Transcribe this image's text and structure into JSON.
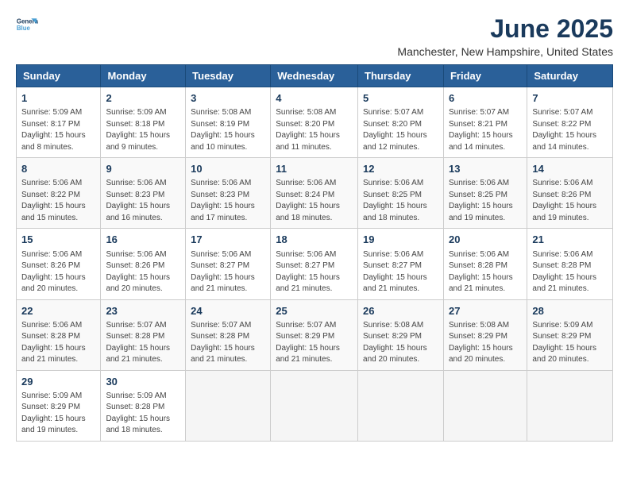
{
  "logo": {
    "line1": "General",
    "line2": "Blue"
  },
  "title": "June 2025",
  "subtitle": "Manchester, New Hampshire, United States",
  "headers": [
    "Sunday",
    "Monday",
    "Tuesday",
    "Wednesday",
    "Thursday",
    "Friday",
    "Saturday"
  ],
  "weeks": [
    [
      {
        "day": "1",
        "info": "Sunrise: 5:09 AM\nSunset: 8:17 PM\nDaylight: 15 hours\nand 8 minutes."
      },
      {
        "day": "2",
        "info": "Sunrise: 5:09 AM\nSunset: 8:18 PM\nDaylight: 15 hours\nand 9 minutes."
      },
      {
        "day": "3",
        "info": "Sunrise: 5:08 AM\nSunset: 8:19 PM\nDaylight: 15 hours\nand 10 minutes."
      },
      {
        "day": "4",
        "info": "Sunrise: 5:08 AM\nSunset: 8:20 PM\nDaylight: 15 hours\nand 11 minutes."
      },
      {
        "day": "5",
        "info": "Sunrise: 5:07 AM\nSunset: 8:20 PM\nDaylight: 15 hours\nand 12 minutes."
      },
      {
        "day": "6",
        "info": "Sunrise: 5:07 AM\nSunset: 8:21 PM\nDaylight: 15 hours\nand 14 minutes."
      },
      {
        "day": "7",
        "info": "Sunrise: 5:07 AM\nSunset: 8:22 PM\nDaylight: 15 hours\nand 14 minutes."
      }
    ],
    [
      {
        "day": "8",
        "info": "Sunrise: 5:06 AM\nSunset: 8:22 PM\nDaylight: 15 hours\nand 15 minutes."
      },
      {
        "day": "9",
        "info": "Sunrise: 5:06 AM\nSunset: 8:23 PM\nDaylight: 15 hours\nand 16 minutes."
      },
      {
        "day": "10",
        "info": "Sunrise: 5:06 AM\nSunset: 8:23 PM\nDaylight: 15 hours\nand 17 minutes."
      },
      {
        "day": "11",
        "info": "Sunrise: 5:06 AM\nSunset: 8:24 PM\nDaylight: 15 hours\nand 18 minutes."
      },
      {
        "day": "12",
        "info": "Sunrise: 5:06 AM\nSunset: 8:25 PM\nDaylight: 15 hours\nand 18 minutes."
      },
      {
        "day": "13",
        "info": "Sunrise: 5:06 AM\nSunset: 8:25 PM\nDaylight: 15 hours\nand 19 minutes."
      },
      {
        "day": "14",
        "info": "Sunrise: 5:06 AM\nSunset: 8:26 PM\nDaylight: 15 hours\nand 19 minutes."
      }
    ],
    [
      {
        "day": "15",
        "info": "Sunrise: 5:06 AM\nSunset: 8:26 PM\nDaylight: 15 hours\nand 20 minutes."
      },
      {
        "day": "16",
        "info": "Sunrise: 5:06 AM\nSunset: 8:26 PM\nDaylight: 15 hours\nand 20 minutes."
      },
      {
        "day": "17",
        "info": "Sunrise: 5:06 AM\nSunset: 8:27 PM\nDaylight: 15 hours\nand 21 minutes."
      },
      {
        "day": "18",
        "info": "Sunrise: 5:06 AM\nSunset: 8:27 PM\nDaylight: 15 hours\nand 21 minutes."
      },
      {
        "day": "19",
        "info": "Sunrise: 5:06 AM\nSunset: 8:27 PM\nDaylight: 15 hours\nand 21 minutes."
      },
      {
        "day": "20",
        "info": "Sunrise: 5:06 AM\nSunset: 8:28 PM\nDaylight: 15 hours\nand 21 minutes."
      },
      {
        "day": "21",
        "info": "Sunrise: 5:06 AM\nSunset: 8:28 PM\nDaylight: 15 hours\nand 21 minutes."
      }
    ],
    [
      {
        "day": "22",
        "info": "Sunrise: 5:06 AM\nSunset: 8:28 PM\nDaylight: 15 hours\nand 21 minutes."
      },
      {
        "day": "23",
        "info": "Sunrise: 5:07 AM\nSunset: 8:28 PM\nDaylight: 15 hours\nand 21 minutes."
      },
      {
        "day": "24",
        "info": "Sunrise: 5:07 AM\nSunset: 8:28 PM\nDaylight: 15 hours\nand 21 minutes."
      },
      {
        "day": "25",
        "info": "Sunrise: 5:07 AM\nSunset: 8:29 PM\nDaylight: 15 hours\nand 21 minutes."
      },
      {
        "day": "26",
        "info": "Sunrise: 5:08 AM\nSunset: 8:29 PM\nDaylight: 15 hours\nand 20 minutes."
      },
      {
        "day": "27",
        "info": "Sunrise: 5:08 AM\nSunset: 8:29 PM\nDaylight: 15 hours\nand 20 minutes."
      },
      {
        "day": "28",
        "info": "Sunrise: 5:09 AM\nSunset: 8:29 PM\nDaylight: 15 hours\nand 20 minutes."
      }
    ],
    [
      {
        "day": "29",
        "info": "Sunrise: 5:09 AM\nSunset: 8:29 PM\nDaylight: 15 hours\nand 19 minutes."
      },
      {
        "day": "30",
        "info": "Sunrise: 5:09 AM\nSunset: 8:28 PM\nDaylight: 15 hours\nand 18 minutes."
      },
      null,
      null,
      null,
      null,
      null
    ]
  ]
}
